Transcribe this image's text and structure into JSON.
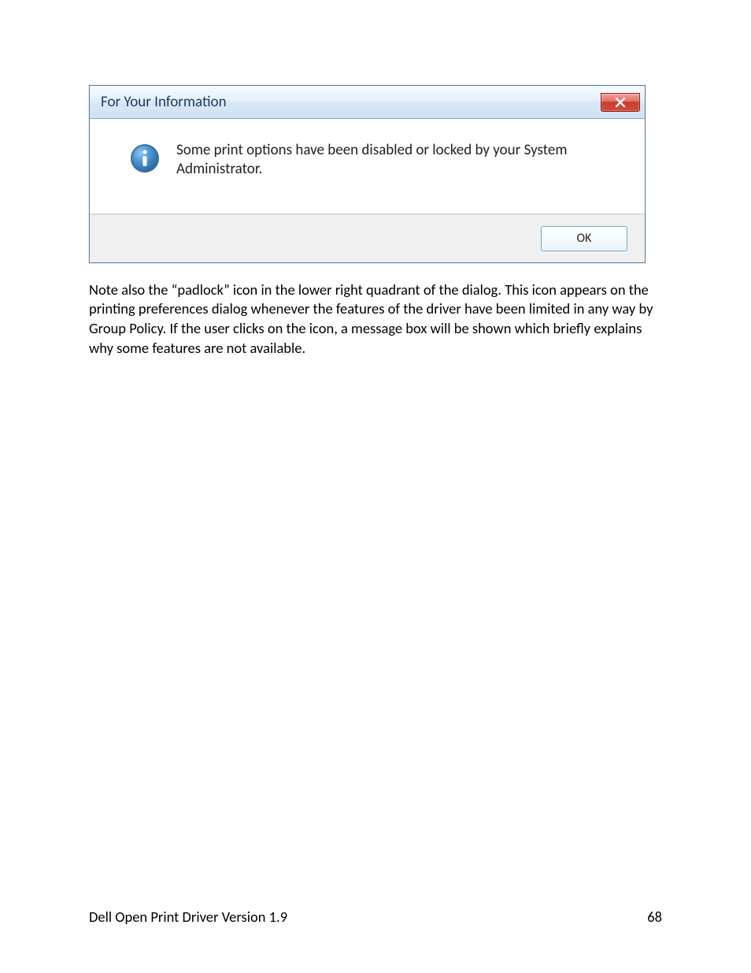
{
  "dialog": {
    "title": "For Your Information",
    "message": "Some print options have been disabled or locked by your System Administrator.",
    "ok_label": "OK"
  },
  "note": "Note also the “padlock” icon in the lower right quadrant of the dialog.  This icon appears on the printing preferences dialog whenever the features of the driver have been limited in any way by Group Policy.  If the user clicks on the icon, a message box will be shown which briefly explains why some features are not available.",
  "footer": {
    "left": "Dell Open Print Driver Version 1.9",
    "page": "68"
  }
}
